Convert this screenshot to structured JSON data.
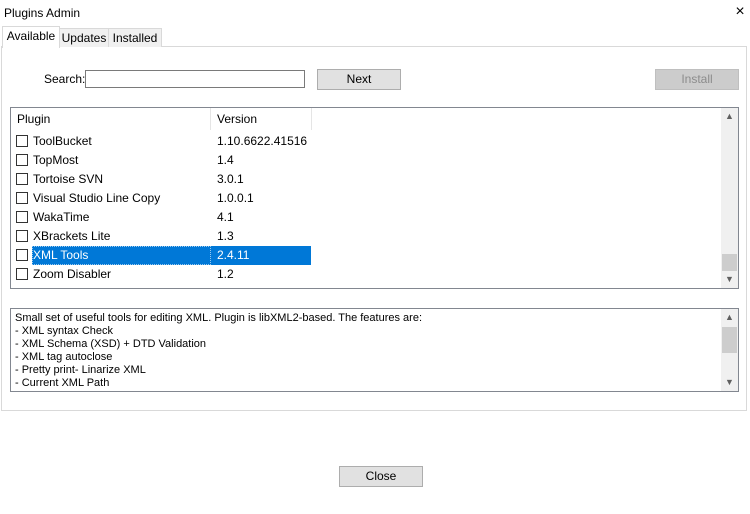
{
  "window": {
    "title": "Plugins Admin",
    "close_glyph": "×"
  },
  "tabs": [
    {
      "label": "Available",
      "active": true
    },
    {
      "label": "Updates",
      "active": false
    },
    {
      "label": "Installed",
      "active": false
    }
  ],
  "search": {
    "label": "Search:",
    "value": "",
    "placeholder": ""
  },
  "buttons": {
    "next": "Next",
    "install": "Install",
    "close": "Close"
  },
  "plugin_list": {
    "columns": [
      "Plugin",
      "Version"
    ],
    "rows": [
      {
        "name": "ToolBucket",
        "version": "1.10.6622.41516",
        "checked": false,
        "selected": false
      },
      {
        "name": "TopMost",
        "version": "1.4",
        "checked": false,
        "selected": false
      },
      {
        "name": "Tortoise SVN",
        "version": "3.0.1",
        "checked": false,
        "selected": false
      },
      {
        "name": "Visual Studio Line Copy",
        "version": "1.0.0.1",
        "checked": false,
        "selected": false
      },
      {
        "name": "WakaTime",
        "version": "4.1",
        "checked": false,
        "selected": false
      },
      {
        "name": "XBrackets Lite",
        "version": "1.3",
        "checked": false,
        "selected": false
      },
      {
        "name": "XML Tools",
        "version": "2.4.11",
        "checked": false,
        "selected": true
      },
      {
        "name": "Zoom Disabler",
        "version": "1.2",
        "checked": false,
        "selected": false
      }
    ]
  },
  "description": {
    "lines": [
      "Small set of useful tools for editing XML. Plugin is libXML2-based. The features are:",
      "- XML syntax Check",
      "- XML Schema (XSD) + DTD Validation",
      "- XML tag autoclose",
      "- Pretty print- Linarize XML",
      "- Current XML Path"
    ]
  },
  "icons": {
    "scroll_up": "scroll-up-icon",
    "scroll_down": "scroll-down-icon"
  },
  "colors": {
    "selection": "#0078d7",
    "disabled_text": "#8c8c8c"
  }
}
